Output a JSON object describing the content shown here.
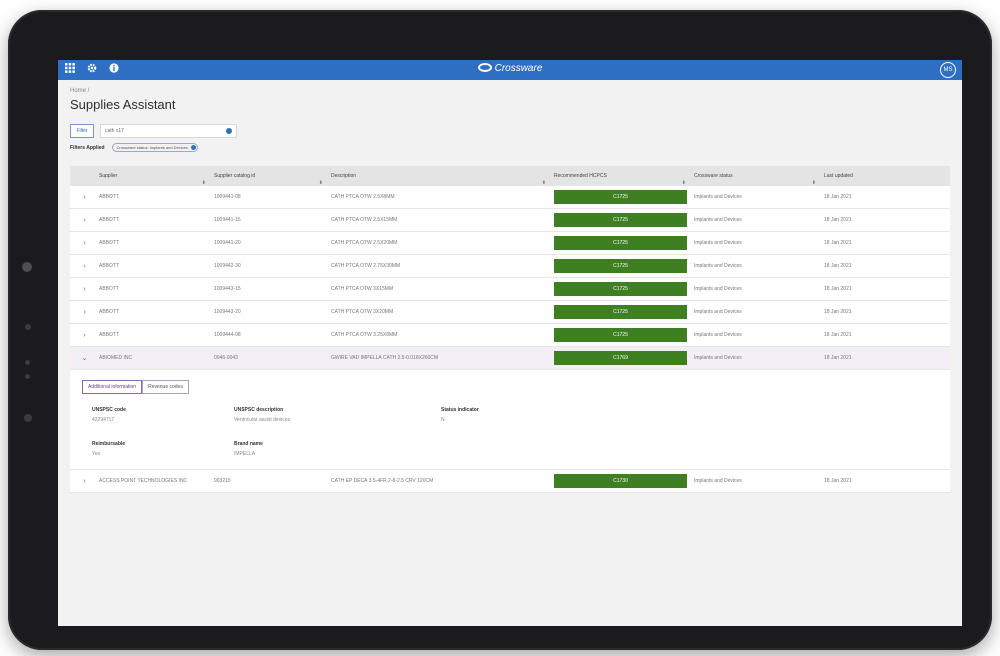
{
  "app": {
    "brand": "Crossware",
    "avatar_initials": "MS",
    "breadcrumb": "Home /",
    "title": "Supplies Assistant"
  },
  "filter": {
    "button_label": "Filter",
    "search_value": "cath c17",
    "applied_label": "Filters Applied",
    "chip_label": "Crossware status: Implants and Devices"
  },
  "columns": [
    "Supplier",
    "Supplier catalog id",
    "Description",
    "Recommended HCPCS",
    "Crossware status",
    "Last updated"
  ],
  "rows": [
    {
      "supplier": "ABBOTT",
      "catalog": "1009441-08",
      "desc": "CATH PTCA OTW 2.5X8MM",
      "hcpcs": "C1725",
      "status": "Implants and Devices",
      "date": "18 Jan 2021"
    },
    {
      "supplier": "ABBOTT",
      "catalog": "1009441-15",
      "desc": "CATH PTCA OTW 2.5X15MM",
      "hcpcs": "C1725",
      "status": "Implants and Devices",
      "date": "18 Jan 2021"
    },
    {
      "supplier": "ABBOTT",
      "catalog": "1009441-20",
      "desc": "CATH PTCA OTW 2.5X20MM",
      "hcpcs": "C1725",
      "status": "Implants and Devices",
      "date": "18 Jan 2021"
    },
    {
      "supplier": "ABBOTT",
      "catalog": "1009442-30",
      "desc": "CATH PTCA OTW 2.75X30MM",
      "hcpcs": "C1725",
      "status": "Implants and Devices",
      "date": "18 Jan 2021"
    },
    {
      "supplier": "ABBOTT",
      "catalog": "1009443-15",
      "desc": "CATH PTCA OTW 3X15MM",
      "hcpcs": "C1725",
      "status": "Implants and Devices",
      "date": "18 Jan 2021"
    },
    {
      "supplier": "ABBOTT",
      "catalog": "1009443-20",
      "desc": "CATH PTCA OTW 3X20MM",
      "hcpcs": "C1725",
      "status": "Implants and Devices",
      "date": "18 Jan 2021"
    },
    {
      "supplier": "ABBOTT",
      "catalog": "1009444-08",
      "desc": "CATH PTCA OTW 3.25X8MM",
      "hcpcs": "C1725",
      "status": "Implants and Devices",
      "date": "18 Jan 2021"
    },
    {
      "supplier": "ABIOMED INC",
      "catalog": "0046-0043",
      "desc": "GWIRE VAD IMPELLA CATH 2.5-0.018X260CM",
      "hcpcs": "C1769",
      "status": "Implants and Devices",
      "date": "18 Jan 2021"
    }
  ],
  "detail": {
    "tab_additional": "Additional information",
    "tab_revenue": "Revenue codes",
    "unspsc_code_label": "UNSPSC code",
    "unspsc_code": "42294717",
    "unspsc_desc_label": "UNSPSC description",
    "unspsc_desc": "Ventricular assist devices",
    "status_indicator_label": "Status indicator",
    "status_indicator": "N",
    "reimbursable_label": "Reimbursable",
    "reimbursable": "Yes",
    "brand_name_label": "Brand name",
    "brand_name": "IMPELLA"
  },
  "last_row": {
    "supplier": "ACCESS POINT TECHNOLOGIES INC",
    "catalog": "903215",
    "desc": "CATH EP DECA 3.5-4FR 2-8-2.5 CRV 120CM",
    "hcpcs": "C1730",
    "status": "Implants and Devices",
    "date": "18 Jan 2021"
  },
  "colors": {
    "brand_blue": "#2e6fc4",
    "hcpcs_green": "#3e7f21",
    "expanded_row": "#f4eef6"
  },
  "icons": [
    "apps-grid-icon",
    "gear-icon",
    "info-icon",
    "chevron-right-icon",
    "chevron-down-icon",
    "sort-icon",
    "clear-icon"
  ]
}
